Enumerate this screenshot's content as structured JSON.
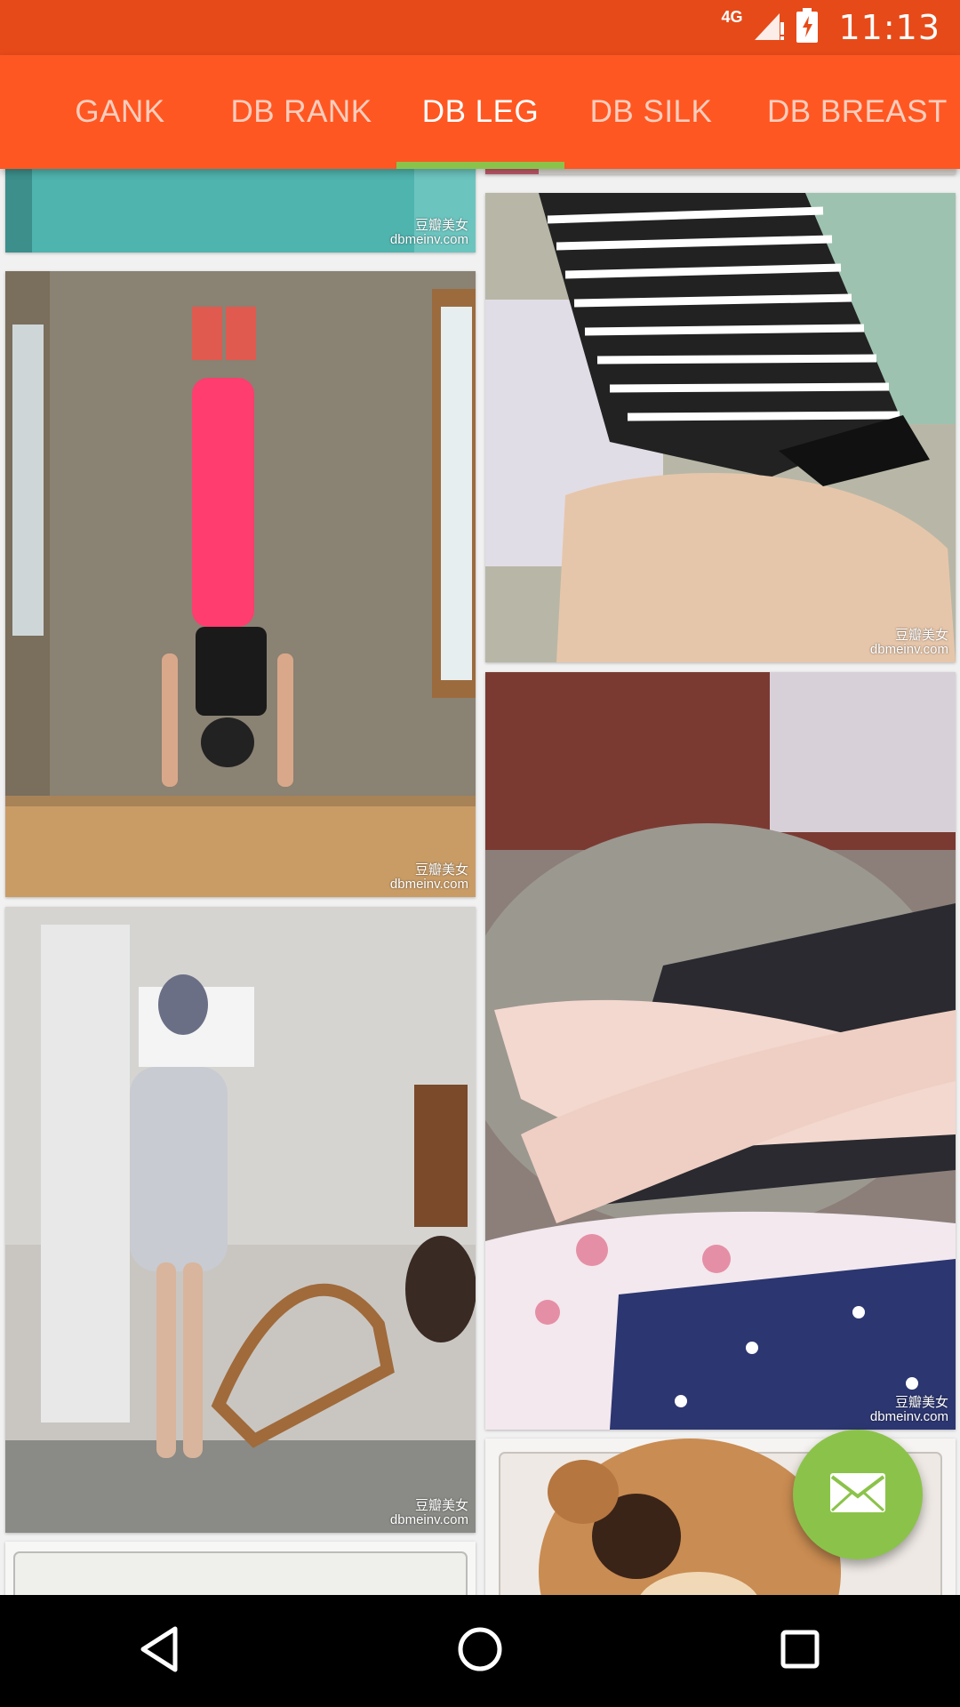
{
  "status_bar": {
    "network_label": "4G",
    "time": "11:13",
    "icons": [
      "signal-icon",
      "battery-charging-icon"
    ]
  },
  "tabs": [
    {
      "label": "GANK",
      "active": false
    },
    {
      "label": "DB RANK",
      "active": false
    },
    {
      "label": "DB LEG",
      "active": true
    },
    {
      "label": "DB SILK",
      "active": false
    },
    {
      "label": "DB BREAST",
      "active": false
    }
  ],
  "watermark": {
    "line1": "豆瓣美女",
    "line2": "dbmeinv.com"
  },
  "fab": {
    "icon": "mail-icon"
  },
  "nav": {
    "back": "back-icon",
    "home": "home-icon",
    "recents": "recents-icon"
  },
  "colors": {
    "status_bar": "#E64A19",
    "toolbar": "#FF5722",
    "indicator": "#8BC34A",
    "fab": "#8BC34A"
  }
}
